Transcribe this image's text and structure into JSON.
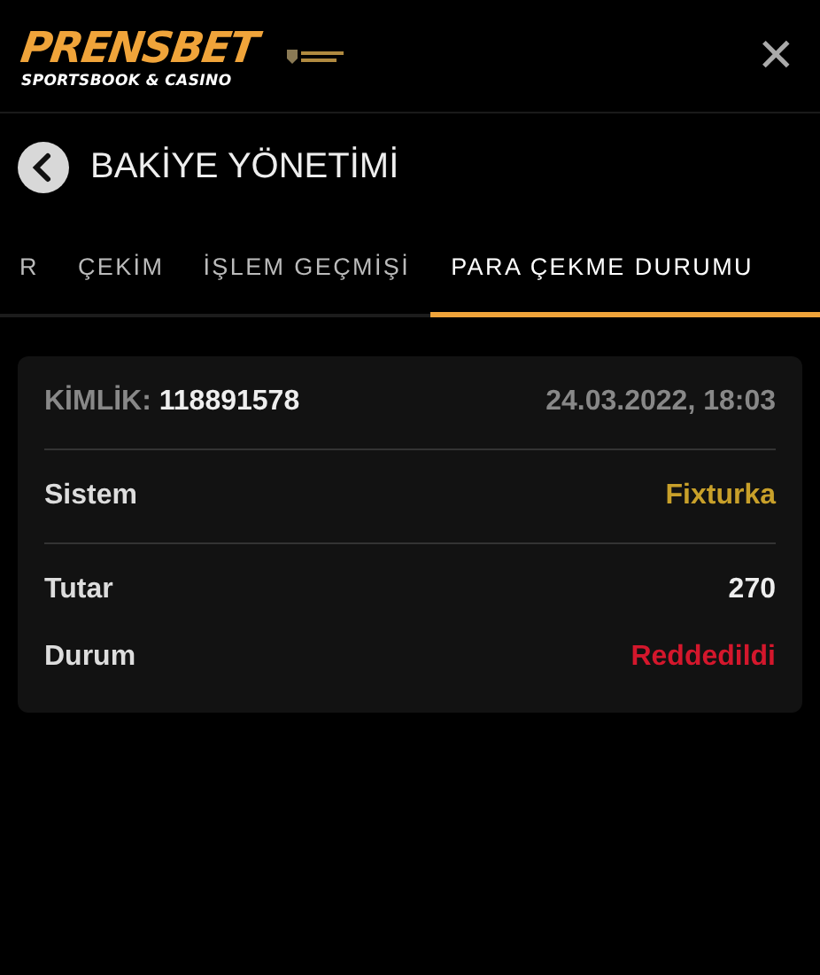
{
  "header": {
    "logo_main": "PRENSBET",
    "logo_sub": "SPORTSBOOK & CASINO",
    "close": "✕"
  },
  "page": {
    "title": "BAKİYE YÖNETİMİ"
  },
  "tabs": [
    {
      "label": "R",
      "selected": false
    },
    {
      "label": "ÇEKİM",
      "selected": false
    },
    {
      "label": "İŞLEM GEÇMİŞİ",
      "selected": false
    },
    {
      "label": "PARA ÇEKME DURUMU",
      "selected": true
    }
  ],
  "card": {
    "id_label": "KİMLİK:",
    "id_value": "118891578",
    "date": "24.03.2022, 18:03",
    "sections": [
      [
        {
          "label": "Sistem",
          "value": "Fixturka",
          "color": "#c8a02a"
        }
      ],
      [
        {
          "label": "Tutar",
          "value": "270",
          "color": "#eeeeee"
        },
        {
          "label": "Durum",
          "value": "Reddedildi",
          "color": "#d4172c"
        }
      ]
    ]
  }
}
